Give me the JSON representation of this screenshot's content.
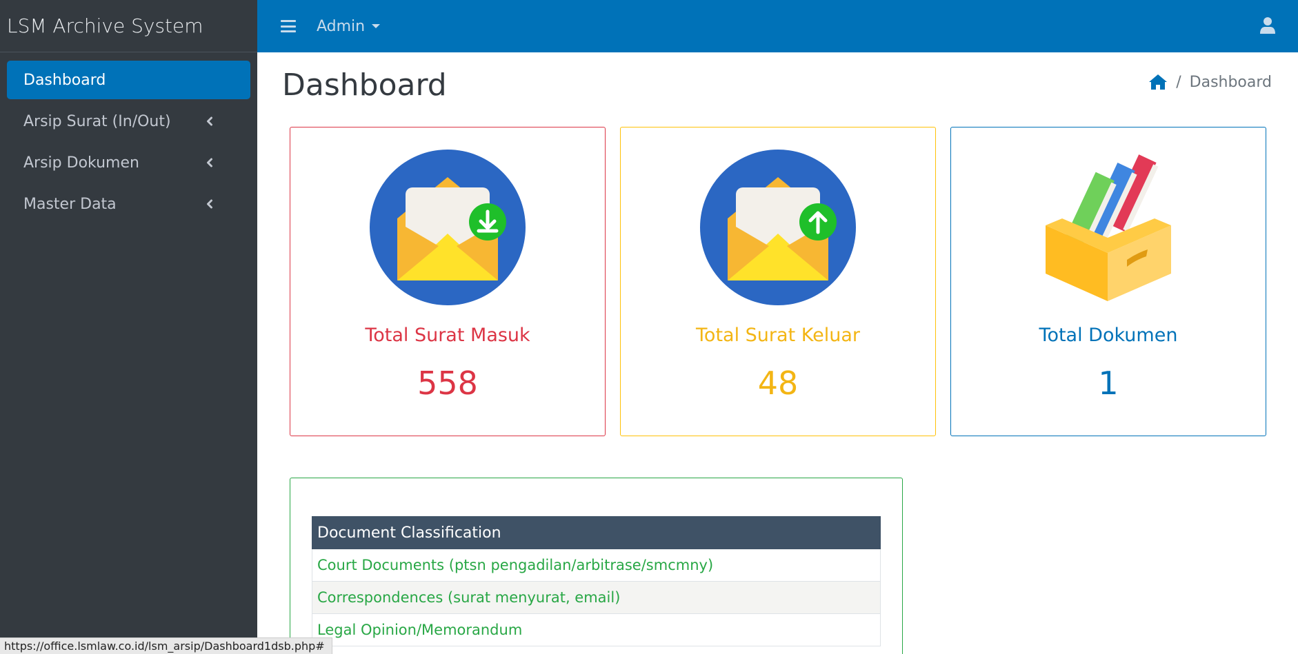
{
  "brand": {
    "title": "LSM Archive System"
  },
  "sidebar": {
    "items": [
      {
        "label": "Dashboard",
        "active": true
      },
      {
        "label": "Arsip Surat (In/Out)"
      },
      {
        "label": "Arsip Dokumen"
      },
      {
        "label": "Master Data"
      }
    ]
  },
  "topbar": {
    "user_label": "Admin"
  },
  "page": {
    "title": "Dashboard"
  },
  "breadcrumb": {
    "current": "Dashboard"
  },
  "cards": [
    {
      "label": "Total Surat Masuk",
      "value": "558",
      "color": "#dc3545",
      "icon": "inbox-mail-download-icon"
    },
    {
      "label": "Total Surat Keluar",
      "value": "48",
      "color": "#ffc107",
      "icon": "outbox-mail-upload-icon"
    },
    {
      "label": "Total Dokumen",
      "value": "1",
      "color": "#0072b8",
      "icon": "document-box-icon"
    }
  ],
  "classification": {
    "header": "Document Classification",
    "rows": [
      "Court Documents (ptsn pengadilan/arbitrase/smcmny)",
      "Correspondences (surat menyurat, email)",
      "Legal Opinion/Memorandum"
    ]
  },
  "status_bar": {
    "url": "https://office.lsmlaw.co.id/lsm_arsip/Dashboard1dsb.php#"
  },
  "colors": {
    "primary": "#0072b8",
    "sidebar": "#343a40",
    "success": "#28a745",
    "danger": "#dc3545",
    "warning": "#ffc107"
  }
}
